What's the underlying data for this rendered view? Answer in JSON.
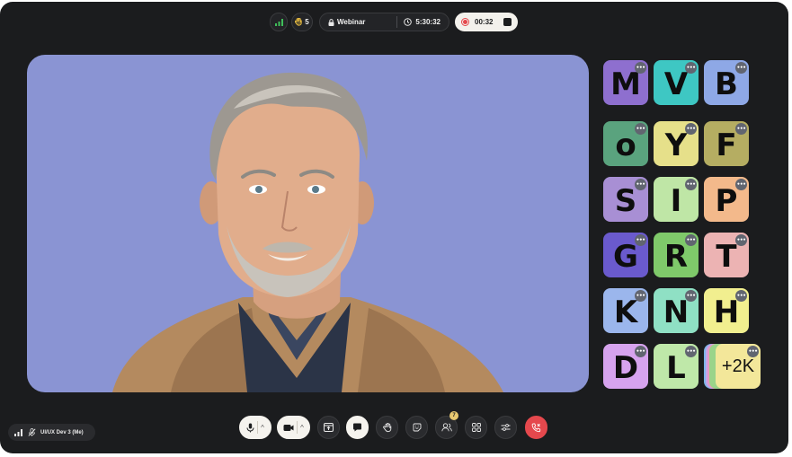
{
  "topbar": {
    "hands_count": "5",
    "room_name": "Webinar",
    "meeting_time": "5:30:32",
    "recording_time": "00:32"
  },
  "participants": [
    {
      "letter": "M",
      "color": "#8e6fcf"
    },
    {
      "letter": "V",
      "color": "#3ec7c3"
    },
    {
      "letter": "B",
      "color": "#8ea8e6"
    },
    {
      "letter": "o",
      "color": "#5aa37e"
    },
    {
      "letter": "Y",
      "color": "#e6e08a"
    },
    {
      "letter": "F",
      "color": "#b5ad62"
    },
    {
      "letter": "S",
      "color": "#a88fd4"
    },
    {
      "letter": "I",
      "color": "#bfe6a6"
    },
    {
      "letter": "P",
      "color": "#f3b98b"
    },
    {
      "letter": "G",
      "color": "#6a5acd"
    },
    {
      "letter": "R",
      "color": "#7fc96a"
    },
    {
      "letter": "T",
      "color": "#ecb3b3"
    },
    {
      "letter": "K",
      "color": "#9bb6ec"
    },
    {
      "letter": "N",
      "color": "#8fe0c4"
    },
    {
      "letter": "H",
      "color": "#f1ef8f"
    },
    {
      "letter": "D",
      "color": "#d6a3ee"
    },
    {
      "letter": "L",
      "color": "#bfe8a9"
    }
  ],
  "overflow": {
    "label": "+2K",
    "color": "#f3e79a"
  },
  "self": {
    "name": "UI/UX Dev 3 (Me)"
  },
  "controls": {
    "participants_badge": "7",
    "end_call_color": "#e5484d"
  },
  "colors": {
    "app_bg": "#1b1c1e",
    "video_bg": "#8a94d3",
    "accent": "#e5484d"
  }
}
